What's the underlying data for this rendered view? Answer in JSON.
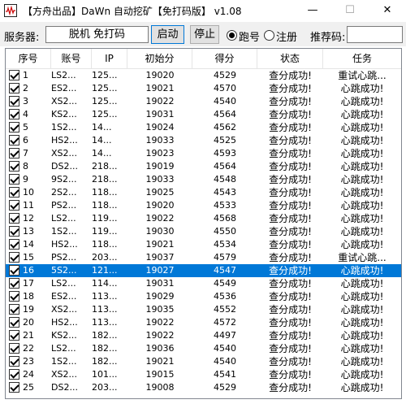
{
  "window": {
    "title": "【方舟出品】DaWn 自动挖矿【免打码版】 v1.08",
    "min_glyph": "—",
    "max_glyph": "☐",
    "close_glyph": "✕"
  },
  "toolbar": {
    "server_label": "服务器:",
    "server_value": "脱机 免打码",
    "start_label": "启动",
    "stop_label": "停止",
    "radio_run_label": "跑号",
    "radio_register_label": "注册",
    "referral_label": "推荐码:",
    "referral_value": ""
  },
  "table": {
    "headers": [
      "序号",
      "账号",
      "IP",
      "初始分",
      "得分",
      "状态",
      "任务"
    ],
    "selected_index": 15,
    "rows": [
      {
        "no": "1",
        "acct": "LS2...",
        "ip": "125...",
        "init": "19020",
        "score": "4529",
        "status": "查分成功!",
        "task": "重试心跳..."
      },
      {
        "no": "2",
        "acct": "ES2...",
        "ip": "125...",
        "init": "19021",
        "score": "4570",
        "status": "查分成功!",
        "task": "心跳成功!"
      },
      {
        "no": "3",
        "acct": "XS2...",
        "ip": "125...",
        "init": "19022",
        "score": "4540",
        "status": "查分成功!",
        "task": "心跳成功!"
      },
      {
        "no": "4",
        "acct": "KS2...",
        "ip": "125...",
        "init": "19031",
        "score": "4564",
        "status": "查分成功!",
        "task": "心跳成功!"
      },
      {
        "no": "5",
        "acct": "1S2...",
        "ip": "14...",
        "init": "19024",
        "score": "4562",
        "status": "查分成功!",
        "task": "心跳成功!"
      },
      {
        "no": "6",
        "acct": "HS2...",
        "ip": "14...",
        "init": "19033",
        "score": "4525",
        "status": "查分成功!",
        "task": "心跳成功!"
      },
      {
        "no": "7",
        "acct": "XS2...",
        "ip": "14...",
        "init": "19023",
        "score": "4593",
        "status": "查分成功!",
        "task": "心跳成功!"
      },
      {
        "no": "8",
        "acct": "DS2...",
        "ip": "218...",
        "init": "19019",
        "score": "4564",
        "status": "查分成功!",
        "task": "心跳成功!"
      },
      {
        "no": "9",
        "acct": "9S2...",
        "ip": "218...",
        "init": "19033",
        "score": "4548",
        "status": "查分成功!",
        "task": "心跳成功!"
      },
      {
        "no": "10",
        "acct": "2S2...",
        "ip": "118...",
        "init": "19025",
        "score": "4543",
        "status": "查分成功!",
        "task": "心跳成功!"
      },
      {
        "no": "11",
        "acct": "PS2...",
        "ip": "118...",
        "init": "19020",
        "score": "4533",
        "status": "查分成功!",
        "task": "心跳成功!"
      },
      {
        "no": "12",
        "acct": "LS2...",
        "ip": "119...",
        "init": "19022",
        "score": "4568",
        "status": "查分成功!",
        "task": "心跳成功!"
      },
      {
        "no": "13",
        "acct": "1S2...",
        "ip": "119...",
        "init": "19030",
        "score": "4550",
        "status": "查分成功!",
        "task": "心跳成功!"
      },
      {
        "no": "14",
        "acct": "HS2...",
        "ip": "118...",
        "init": "19021",
        "score": "4534",
        "status": "查分成功!",
        "task": "心跳成功!"
      },
      {
        "no": "15",
        "acct": "PS2...",
        "ip": "203...",
        "init": "19037",
        "score": "4579",
        "status": "查分成功!",
        "task": "重试心跳..."
      },
      {
        "no": "16",
        "acct": "5S2...",
        "ip": "121...",
        "init": "19027",
        "score": "4547",
        "status": "查分成功!",
        "task": "心跳成功!"
      },
      {
        "no": "17",
        "acct": "LS2...",
        "ip": "114...",
        "init": "19031",
        "score": "4549",
        "status": "查分成功!",
        "task": "心跳成功!"
      },
      {
        "no": "18",
        "acct": "ES2...",
        "ip": "113...",
        "init": "19029",
        "score": "4536",
        "status": "查分成功!",
        "task": "心跳成功!"
      },
      {
        "no": "19",
        "acct": "XS2...",
        "ip": "113...",
        "init": "19035",
        "score": "4552",
        "status": "查分成功!",
        "task": "心跳成功!"
      },
      {
        "no": "20",
        "acct": "HS2...",
        "ip": "113...",
        "init": "19022",
        "score": "4572",
        "status": "查分成功!",
        "task": "心跳成功!"
      },
      {
        "no": "21",
        "acct": "KS2...",
        "ip": "182...",
        "init": "19022",
        "score": "4497",
        "status": "查分成功!",
        "task": "心跳成功!"
      },
      {
        "no": "22",
        "acct": "LS2...",
        "ip": "182...",
        "init": "19036",
        "score": "4540",
        "status": "查分成功!",
        "task": "心跳成功!"
      },
      {
        "no": "23",
        "acct": "1S2...",
        "ip": "182...",
        "init": "19021",
        "score": "4540",
        "status": "查分成功!",
        "task": "心跳成功!"
      },
      {
        "no": "24",
        "acct": "XS2...",
        "ip": "101...",
        "init": "19015",
        "score": "4541",
        "status": "查分成功!",
        "task": "心跳成功!"
      },
      {
        "no": "25",
        "acct": "DS2...",
        "ip": "203...",
        "init": "19008",
        "score": "4529",
        "status": "查分成功!",
        "task": "心跳成功!"
      }
    ]
  }
}
